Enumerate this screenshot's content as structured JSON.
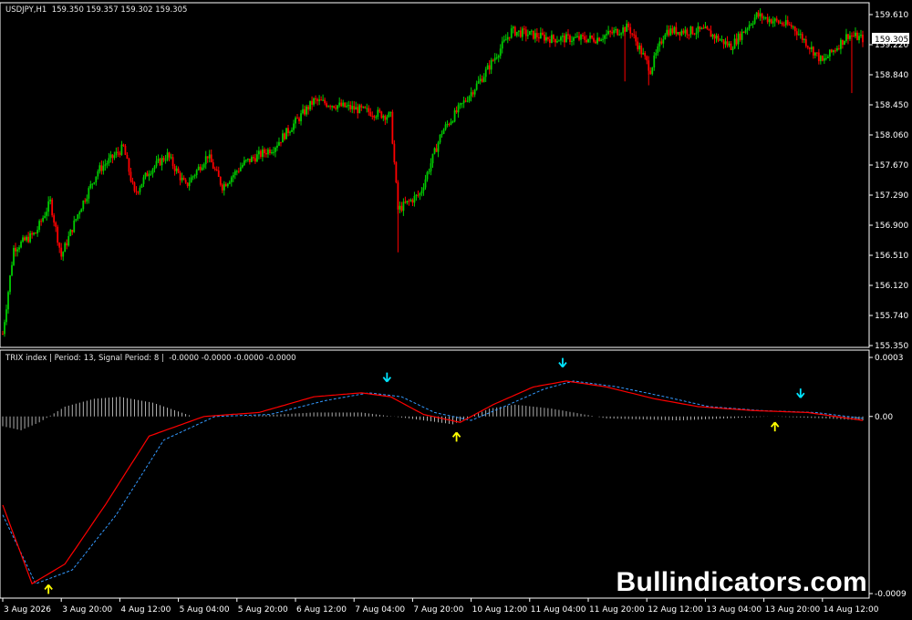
{
  "main_chart": {
    "header": "USDJPY,H1  159.350 159.357 159.302 159.305",
    "price_labels": [
      "159.610",
      "159.220",
      "158.840",
      "158.450",
      "158.060",
      "157.670",
      "157.290",
      "156.900",
      "156.510",
      "156.120",
      "155.740",
      "155.350"
    ],
    "current_price": "159.305",
    "colors": {
      "bull": "#00cc00",
      "bear": "#ff0000",
      "background": "#000000",
      "price_box": "#ffffff"
    }
  },
  "indicator": {
    "header": "TRIX index | Period: 13, Signal Period: 8 |  -0.0000 -0.0000 -0.0000 -0.0000",
    "scale_labels": [
      "0.0003",
      "0.00",
      "-0.0009"
    ],
    "colors": {
      "trix": "#ff0000",
      "signal": "#3399ff",
      "histogram": "#d8d8d8",
      "arrow_up": "#ffff00",
      "arrow_down": "#00e5ff"
    },
    "arrows": [
      {
        "type": "up",
        "bar": 25
      },
      {
        "type": "down",
        "bar": 210
      },
      {
        "type": "up",
        "bar": 248
      },
      {
        "type": "down",
        "bar": 306
      },
      {
        "type": "up",
        "bar": 422
      },
      {
        "type": "down",
        "bar": 436
      }
    ]
  },
  "time_labels": [
    "3 Aug 2026",
    "3 Aug 20:00",
    "4 Aug 12:00",
    "5 Aug 04:00",
    "5 Aug 20:00",
    "6 Aug 12:00",
    "7 Aug 04:00",
    "7 Aug 20:00",
    "10 Aug 12:00",
    "11 Aug 04:00",
    "11 Aug 20:00",
    "12 Aug 12:00",
    "13 Aug 04:00",
    "13 Aug 20:00",
    "14 Aug 12:00"
  ],
  "watermark": "Bullindicators.com",
  "chart_data": {
    "type": "candlestick",
    "symbol": "USDJPY",
    "timeframe": "H1",
    "ylim": [
      155.35,
      159.61
    ],
    "price_path": [
      [
        0,
        155.5
      ],
      [
        6,
        156.6
      ],
      [
        18,
        156.8
      ],
      [
        26,
        157.2
      ],
      [
        32,
        156.5
      ],
      [
        42,
        157.1
      ],
      [
        52,
        157.6
      ],
      [
        66,
        157.9
      ],
      [
        72,
        157.3
      ],
      [
        80,
        157.6
      ],
      [
        90,
        157.8
      ],
      [
        100,
        157.4
      ],
      [
        112,
        157.8
      ],
      [
        120,
        157.4
      ],
      [
        132,
        157.7
      ],
      [
        148,
        157.9
      ],
      [
        170,
        158.5
      ],
      [
        192,
        158.4
      ],
      [
        212,
        158.3
      ],
      [
        216,
        157.1
      ],
      [
        228,
        157.3
      ],
      [
        240,
        158.1
      ],
      [
        262,
        158.8
      ],
      [
        278,
        159.4
      ],
      [
        300,
        159.3
      ],
      [
        324,
        159.3
      ],
      [
        342,
        159.45
      ],
      [
        354,
        158.9
      ],
      [
        362,
        159.4
      ],
      [
        384,
        159.4
      ],
      [
        398,
        159.2
      ],
      [
        412,
        159.6
      ],
      [
        432,
        159.45
      ],
      [
        448,
        159.0
      ],
      [
        462,
        159.35
      ],
      [
        470,
        159.3
      ]
    ],
    "trix_path": [
      [
        0,
        -0.00045
      ],
      [
        16,
        -0.00085
      ],
      [
        34,
        -0.00075
      ],
      [
        56,
        -0.00045
      ],
      [
        80,
        -0.0001
      ],
      [
        110,
        0.0
      ],
      [
        140,
        2e-05
      ],
      [
        170,
        0.0001
      ],
      [
        196,
        0.00012
      ],
      [
        212,
        0.0001
      ],
      [
        230,
        1e-05
      ],
      [
        250,
        -3e-05
      ],
      [
        268,
        6e-05
      ],
      [
        290,
        0.00015
      ],
      [
        308,
        0.00018
      ],
      [
        330,
        0.00015
      ],
      [
        356,
        9e-05
      ],
      [
        380,
        5e-05
      ],
      [
        410,
        3e-05
      ],
      [
        440,
        2e-05
      ],
      [
        470,
        -2e-05
      ]
    ],
    "signal_path": [
      [
        0,
        -0.0005
      ],
      [
        18,
        -0.00085
      ],
      [
        38,
        -0.00078
      ],
      [
        62,
        -0.0005
      ],
      [
        88,
        -0.00012
      ],
      [
        116,
        0.0
      ],
      [
        146,
        1e-05
      ],
      [
        176,
        8e-05
      ],
      [
        200,
        0.00012
      ],
      [
        218,
        0.0001
      ],
      [
        236,
        2e-05
      ],
      [
        256,
        -2e-05
      ],
      [
        274,
        5e-05
      ],
      [
        296,
        0.00014
      ],
      [
        312,
        0.00018
      ],
      [
        336,
        0.00015
      ],
      [
        362,
        0.0001
      ],
      [
        386,
        5e-05
      ],
      [
        414,
        3e-05
      ],
      [
        444,
        2e-05
      ],
      [
        470,
        -1e-05
      ]
    ],
    "hist_path": [
      [
        0,
        -5e-05
      ],
      [
        10,
        -7e-05
      ],
      [
        20,
        -3e-05
      ],
      [
        34,
        5e-05
      ],
      [
        50,
        9e-05
      ],
      [
        64,
        0.0001
      ],
      [
        82,
        7e-05
      ],
      [
        104,
        0.0
      ],
      [
        130,
        0.0
      ],
      [
        170,
        2e-05
      ],
      [
        196,
        2e-05
      ],
      [
        222,
        -1e-05
      ],
      [
        246,
        -4e-05
      ],
      [
        266,
        4e-05
      ],
      [
        280,
        6e-05
      ],
      [
        300,
        4e-05
      ],
      [
        330,
        -1e-05
      ],
      [
        370,
        -2e-05
      ],
      [
        420,
        0.0
      ],
      [
        450,
        -1e-05
      ],
      [
        470,
        -2e-05
      ]
    ],
    "seed": 7
  }
}
